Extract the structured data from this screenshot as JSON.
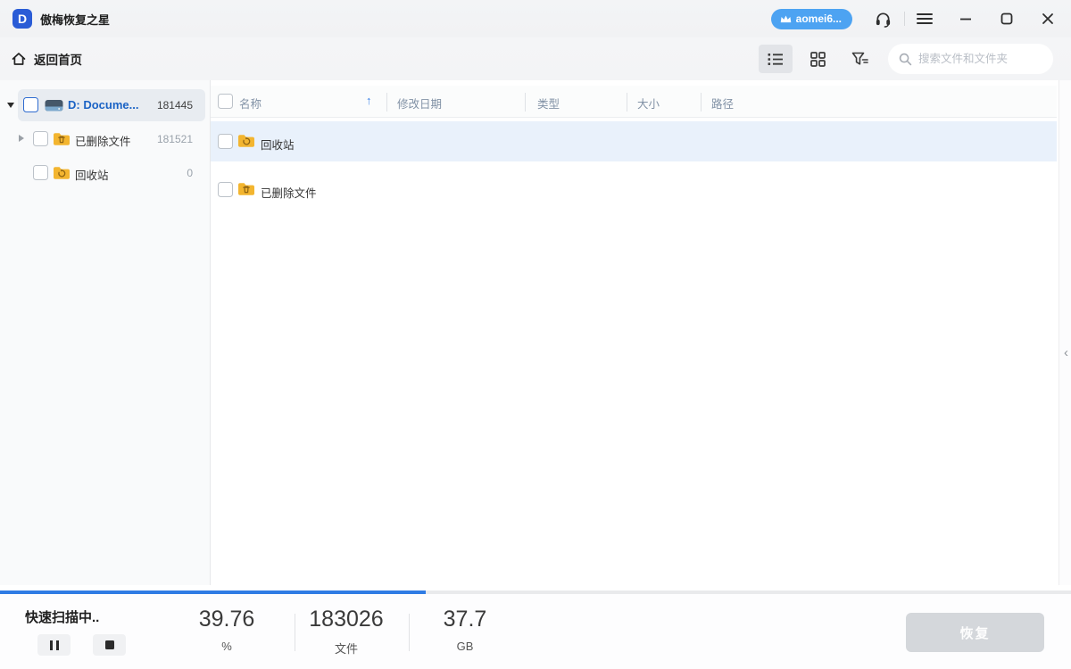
{
  "titlebar": {
    "app_title": "傲梅恢复之星",
    "logo_letter": "D",
    "account_badge": "aomei6..."
  },
  "toolbar": {
    "back_home_label": "返回首页",
    "search_placeholder": "搜索文件和文件夹"
  },
  "sidebar": {
    "items": [
      {
        "label": "D: Docume...",
        "count": "181445",
        "type": "drive",
        "selected": true,
        "expanded": true
      },
      {
        "label": "已删除文件",
        "count": "181521",
        "type": "folder-deleted",
        "selected": false
      },
      {
        "label": "回收站",
        "count": "0",
        "type": "folder-recycle",
        "selected": false
      }
    ]
  },
  "table": {
    "columns": [
      {
        "label": "名称"
      },
      {
        "label": "修改日期"
      },
      {
        "label": "类型"
      },
      {
        "label": "大小"
      },
      {
        "label": "路径"
      }
    ],
    "sort_icon": "↑",
    "rows": [
      {
        "name": "回收站",
        "icon": "folder-recycle",
        "selected": true
      },
      {
        "name": "已删除文件",
        "icon": "folder-deleted",
        "selected": false
      }
    ]
  },
  "right_panel": {
    "collapse_chevron": "‹"
  },
  "footer": {
    "status_text": "快速扫描中..",
    "progress_percent": 39.76,
    "stats": [
      {
        "value": "39.76",
        "label": "%"
      },
      {
        "value": "183026",
        "label": "文件"
      },
      {
        "value": "37.7",
        "label": "GB"
      }
    ],
    "recover_label": "恢复"
  },
  "colors": {
    "accent_blue": "#2f7ce4",
    "badge_blue": "#4da3f2",
    "selected_row_bg": "#e9f1fb",
    "folder_yellow": "#f3b52f",
    "disabled_button_bg": "#d4d7db"
  }
}
